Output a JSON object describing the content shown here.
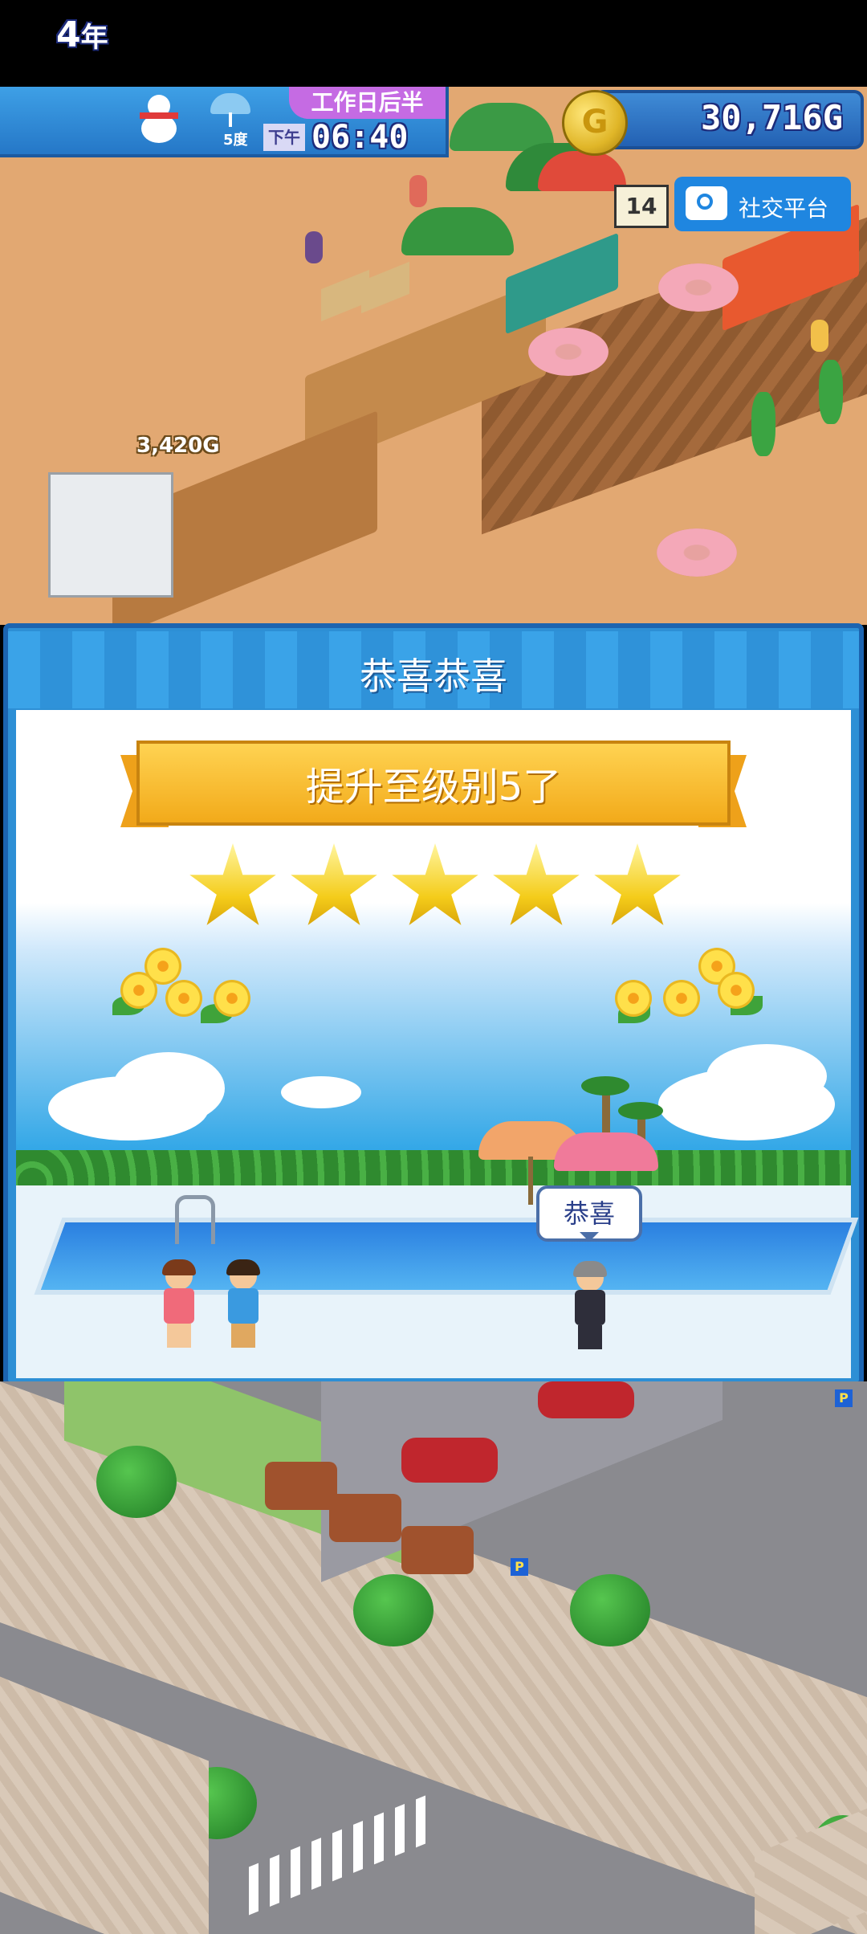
{
  "hud": {
    "year": "4",
    "year_unit": "年",
    "temperature": "5度",
    "period": "工作日后半",
    "ampm": "下午",
    "time": "06:40",
    "money": "30,716G",
    "coin_symbol": "G",
    "notification_count": "14",
    "social_label": "社交平台"
  },
  "world": {
    "price_tag": "3,420G"
  },
  "dialog": {
    "title": "恭喜恭喜",
    "ribbon_text": "提升至级别5了",
    "stars": 5,
    "speech": "恭喜"
  },
  "colors": {
    "accent_blue": "#2d8fd5",
    "ribbon_gold": "#f2aa1a",
    "star_yellow": "#f4cc1a",
    "sand": "#e2a872"
  }
}
